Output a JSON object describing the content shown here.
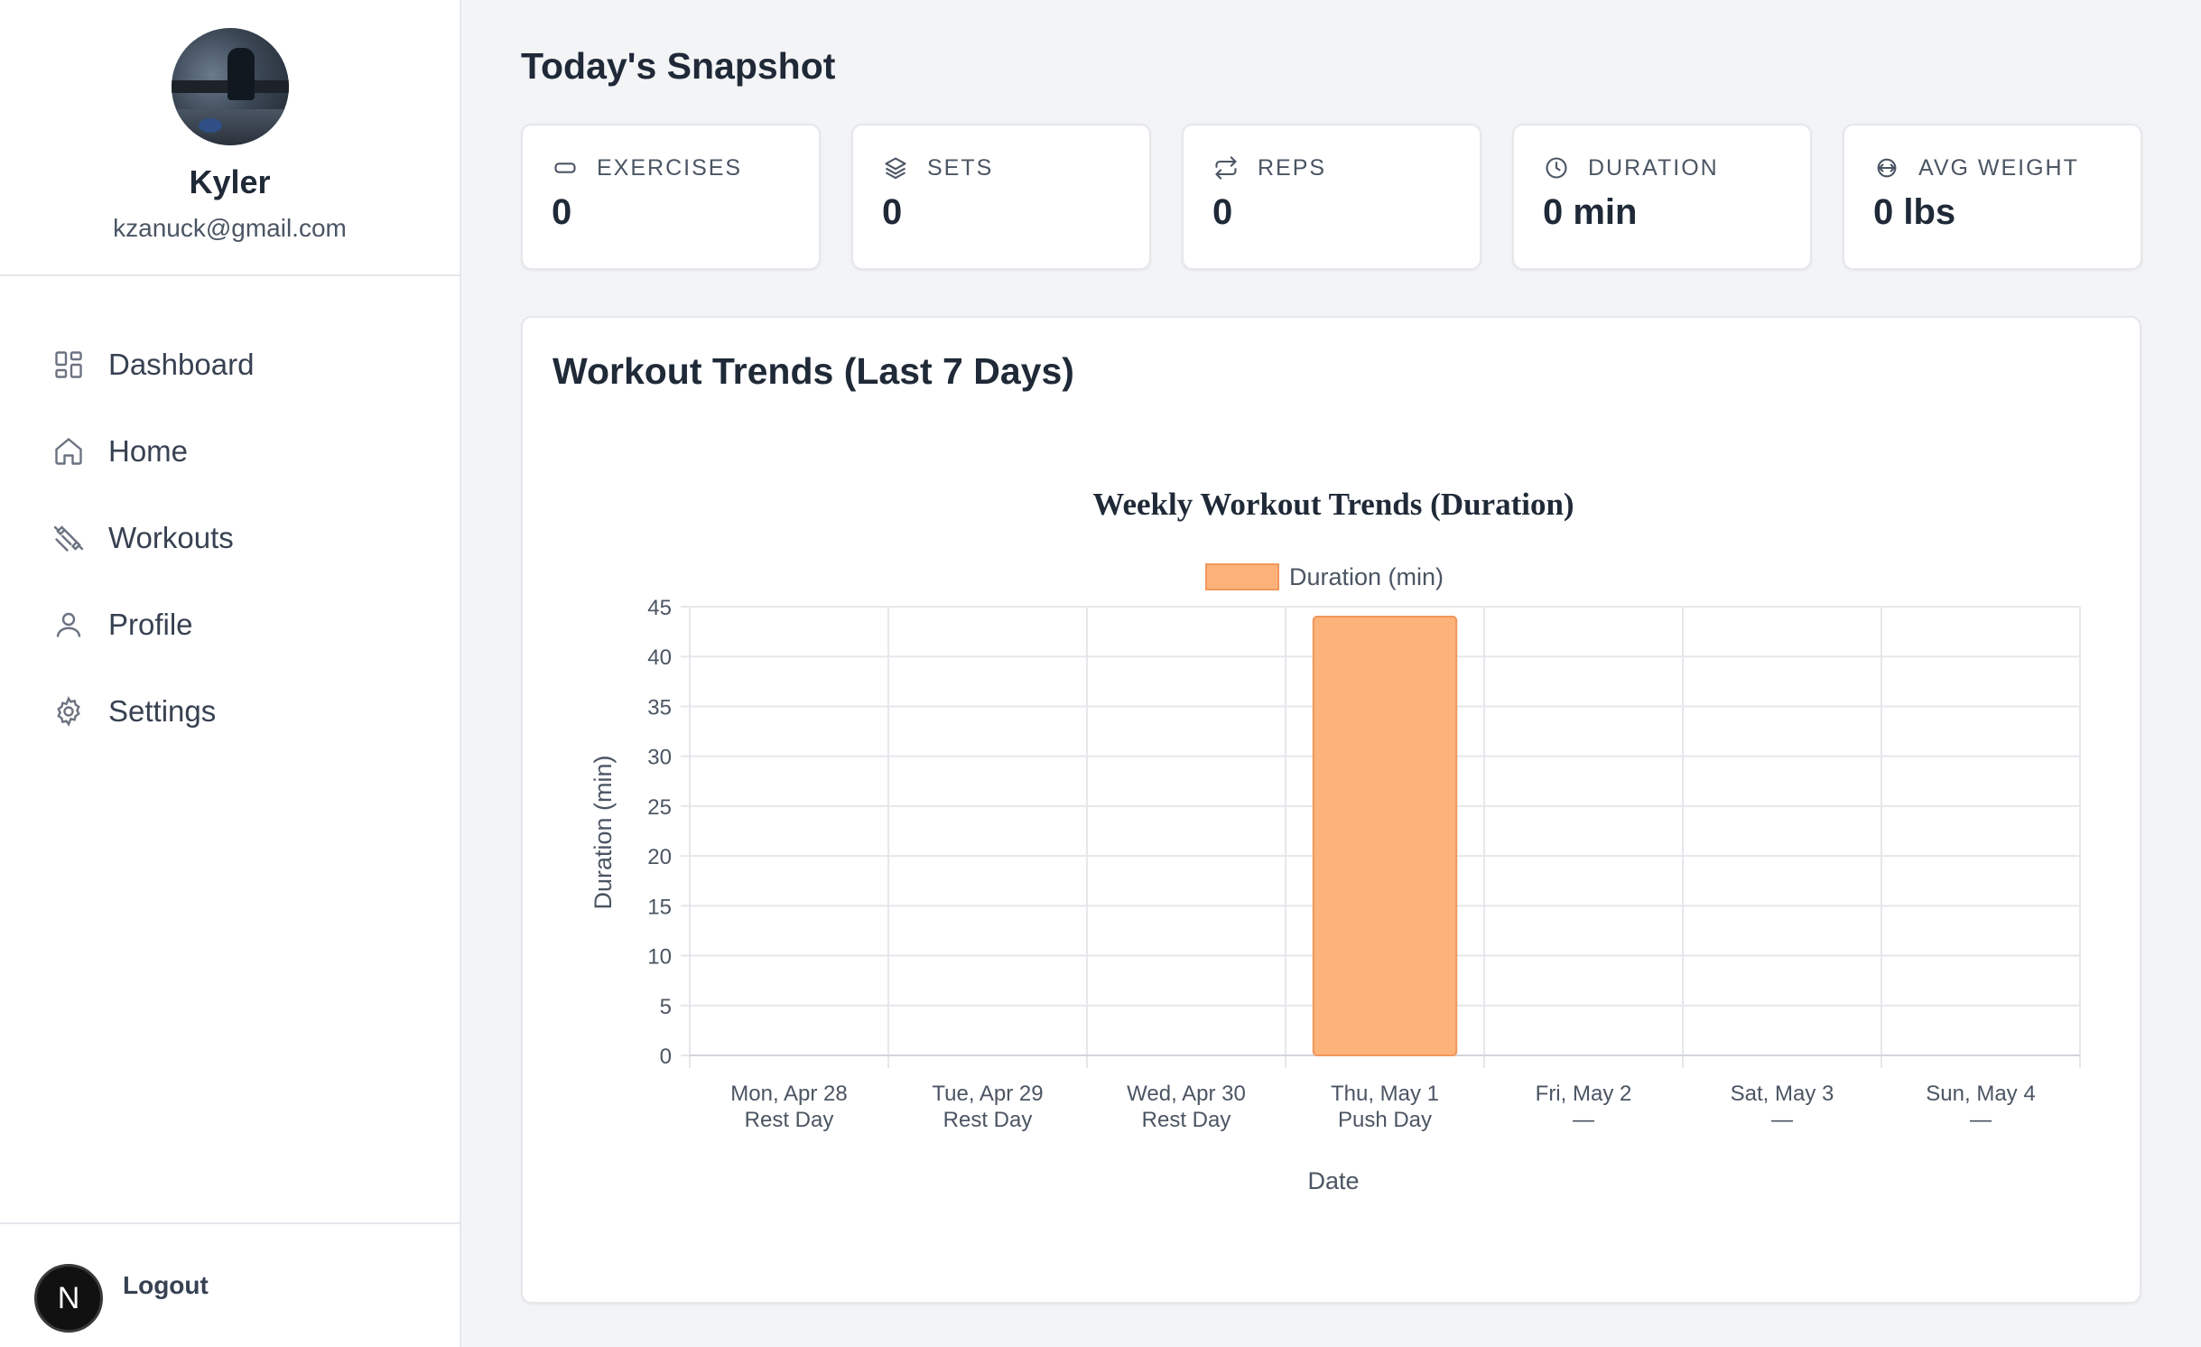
{
  "sidebar": {
    "user": {
      "name": "Kyler",
      "email": "kzanuck@gmail.com"
    },
    "nav": [
      {
        "label": "Dashboard",
        "icon": "dashboard-icon"
      },
      {
        "label": "Home",
        "icon": "home-icon"
      },
      {
        "label": "Workouts",
        "icon": "dumbbell-icon"
      },
      {
        "label": "Profile",
        "icon": "user-icon"
      },
      {
        "label": "Settings",
        "icon": "gear-icon"
      }
    ],
    "footer": {
      "badge": "N",
      "logout_label": "Logout"
    }
  },
  "main": {
    "title": "Today's Snapshot",
    "stats": [
      {
        "label": "EXERCISES",
        "value": "0",
        "icon": "exercise-icon"
      },
      {
        "label": "SETS",
        "value": "0",
        "icon": "layers-icon"
      },
      {
        "label": "REPS",
        "value": "0",
        "icon": "repeat-icon"
      },
      {
        "label": "DURATION",
        "value": "0 min",
        "icon": "clock-icon"
      },
      {
        "label": "AVG WEIGHT",
        "value": "0 lbs",
        "icon": "weight-icon"
      }
    ],
    "trends_title": "Workout Trends (Last 7 Days)"
  },
  "colors": {
    "bar_fill": "#fdb27a",
    "bar_stroke": "#f0975a",
    "grid": "#e5e7eb"
  },
  "chart_data": {
    "type": "bar",
    "title": "Weekly Workout Trends (Duration)",
    "xlabel": "Date",
    "ylabel": "Duration (min)",
    "categories": [
      [
        "Mon, Apr 28",
        "Rest Day"
      ],
      [
        "Tue, Apr 29",
        "Rest Day"
      ],
      [
        "Wed, Apr 30",
        "Rest Day"
      ],
      [
        "Thu, May 1",
        "Push Day"
      ],
      [
        "Fri, May 2",
        "—"
      ],
      [
        "Sat, May 3",
        "—"
      ],
      [
        "Sun, May 4",
        "—"
      ]
    ],
    "series": [
      {
        "name": "Duration (min)",
        "values": [
          0,
          0,
          0,
          44,
          0,
          0,
          0
        ]
      }
    ],
    "ylim": [
      0,
      45
    ],
    "yticks": [
      0,
      5,
      10,
      15,
      20,
      25,
      30,
      35,
      40,
      45
    ],
    "grid": true,
    "legend": "top-center"
  }
}
